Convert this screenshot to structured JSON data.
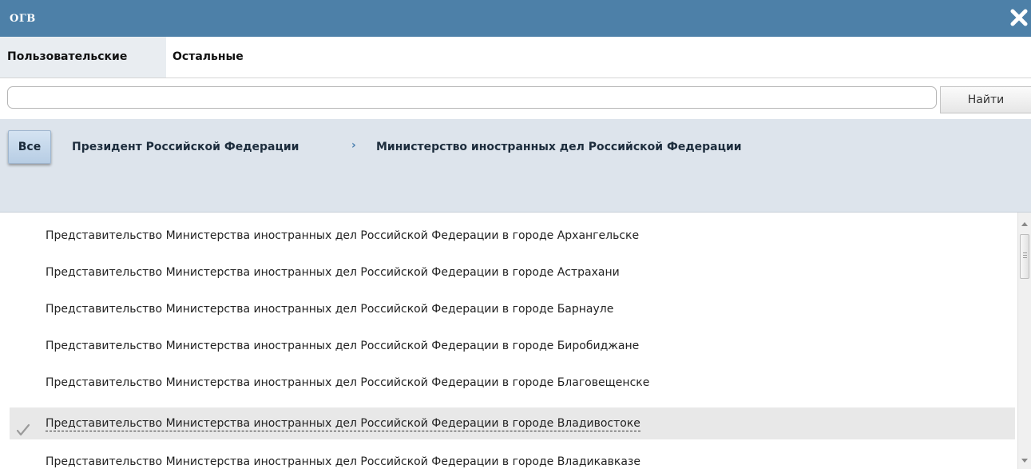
{
  "window": {
    "title": "ОГВ",
    "close_icon": "close-x-icon"
  },
  "tabs": [
    {
      "label": "Пользовательские",
      "active": true
    },
    {
      "label": "Остальные",
      "active": false
    }
  ],
  "search": {
    "value": "",
    "placeholder": "",
    "button_label": "Найти"
  },
  "breadcrumb": {
    "all_label": "Все",
    "items": [
      "Президент Российской Федерации",
      "Министерство иностранных дел Российской Федерации"
    ],
    "separator": "›"
  },
  "list": {
    "items": [
      {
        "label": "Представительство Министерства иностранных дел Российской Федерации в городе Архангельске",
        "selected": false
      },
      {
        "label": "Представительство Министерства иностранных дел Российской Федерации в городе Астрахани",
        "selected": false
      },
      {
        "label": "Представительство Министерства иностранных дел Российской Федерации в городе Барнауле",
        "selected": false
      },
      {
        "label": "Представительство Министерства иностранных дел Российской Федерации в городе Биробиджане",
        "selected": false
      },
      {
        "label": "Представительство Министерства иностранных дел Российской Федерации в городе Благовещенске",
        "selected": false
      },
      {
        "label": "Представительство Министерства иностранных дел Российской Федерации в городе Владивостоке",
        "selected": true
      },
      {
        "label": "Представительство Министерства иностранных дел Российской Федерации в городе Владикавказе",
        "selected": false
      }
    ]
  },
  "colors": {
    "titlebar": "#4d80a8",
    "breadcrumb_bg": "#dde4ec",
    "selected_row": "#e8e8e8"
  }
}
